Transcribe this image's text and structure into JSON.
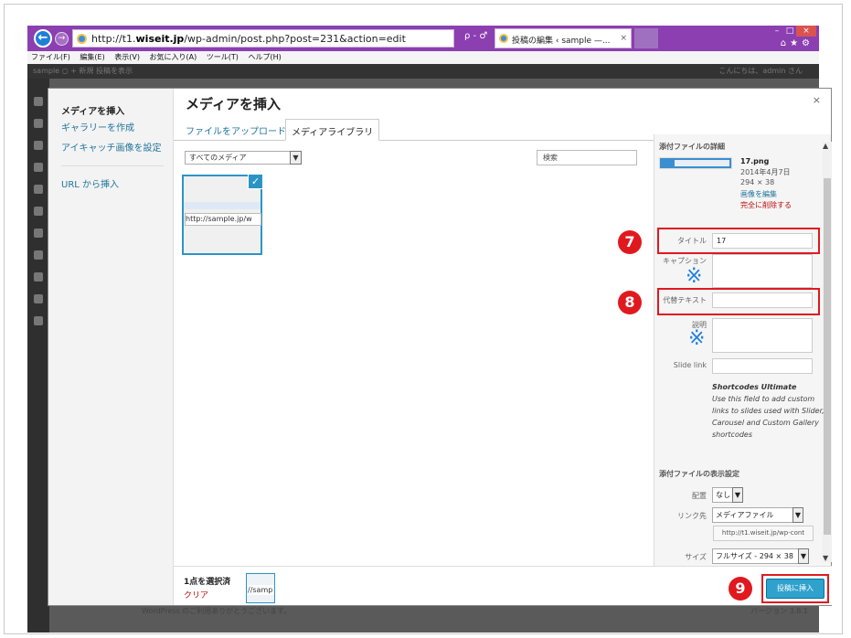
{
  "browser": {
    "url_prefix": "http://t1.",
    "url_domain": "wiseit.jp",
    "url_path": "/wp-admin/post.php?post=231&action=edit",
    "addr_tools": "ρ - ♂",
    "tab_title": "投稿の編集 ‹ sample —...",
    "tab_close": "×",
    "menu": [
      "ファイル(F)",
      "編集(E)",
      "表示(V)",
      "お気に入り(A)",
      "ツール(T)",
      "ヘルプ(H)"
    ]
  },
  "adminbar": {
    "left": "sample   ○   + 新規   投稿を表示",
    "right": "こんにちは、admin さん"
  },
  "modal": {
    "title": "メディアを挿入",
    "close": "×",
    "sidebar": {
      "title": "メディアを挿入",
      "gallery": "ギャラリーを作成",
      "featured": "アイキャッチ画像を設定",
      "from_url": "URL から挿入"
    },
    "tabs": {
      "upload": "ファイルをアップロード",
      "library": "メディアライブラリ"
    },
    "filter": "すべてのメディア",
    "search": "検索",
    "attachment_url": "http://sample.jp/w"
  },
  "details": {
    "heading": "添付ファイルの詳細",
    "file_name": "17.png",
    "date": "2014年4月7日",
    "dimensions": "294 × 38",
    "edit_link": "画像を編集",
    "delete_link": "完全に削除する",
    "title_label": "タイトル",
    "title_value": "17",
    "caption_label": "キャプション",
    "alt_label": "代替テキスト",
    "desc_label": "説明",
    "slide_label": "Slide link",
    "kome": "※",
    "sc_title": "Shortcodes Ultimate",
    "sc_body": "Use this field to add custom links to slides used with Slider, Carousel and Custom Gallery shortcodes",
    "settings_heading": "添付ファイルの表示設定",
    "align_label": "配置",
    "align_value": "なし",
    "link_label": "リンク先",
    "link_value": "メディアファイル",
    "link_url": "http://t1.wiseit.jp/wp-cont",
    "size_label": "サイズ",
    "size_value": "フルサイズ - 294 × 38"
  },
  "bottom": {
    "selected": "1点を選択済",
    "clear": "クリア",
    "mini_url": "//samp",
    "insert": "投稿に挿入"
  },
  "badges": [
    "7",
    "8",
    "9"
  ],
  "footer": {
    "left": "WordPress のご利用ありがとうございます。",
    "right": "バージョン 3.8.1"
  }
}
